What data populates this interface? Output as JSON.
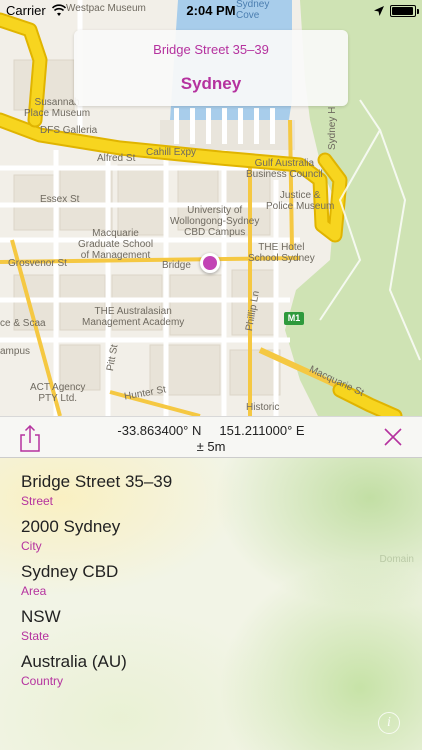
{
  "status_bar": {
    "carrier": "Carrier",
    "wifi_icon": "wifi-icon",
    "time": "2:04 PM",
    "location_icon": "location-arrow-icon",
    "battery_level": 0.95
  },
  "map": {
    "labels": {
      "westpac": "Westpac Museum",
      "sydney_cove": "Sydney\nCove",
      "susannah": "Susannah\nPlace Museum",
      "dfs": "DFS Galleria",
      "cahill": "Cahill Expy",
      "alfred": "Alfred St",
      "gulf": "Gulf Australia\nBusiness Council",
      "justice": "Justice &\nPolice Museum",
      "essex": "Essex St",
      "uow": "University of\nWollongong-Sydney\nCBD Campus",
      "macquarie_grad": "Macquarie\nGraduate School\nof Management",
      "hotel": "THE Hotel\nSchool Sydney",
      "grosvenor": "Grosvenor St",
      "bridge": "Bridge",
      "aus_mgmt": "THE Australasian\nManagement Academy",
      "phillip": "Phillip Ln",
      "pitt": "Pitt St",
      "hunter": "Hunter St",
      "act_agency": "ACT Agency\nPTY Ltd.",
      "historic": "Historic",
      "macquarie_st": "Macquarie St",
      "sydney_h": "Sydney H",
      "scaa": "ce & Scaa",
      "campus": "ampus",
      "m1": "M1"
    }
  },
  "callout": {
    "subtitle": "Bridge Street 35–39",
    "title": "Sydney"
  },
  "coordinates": {
    "latitude": "-33.863400° N",
    "longitude": "151.211000° E",
    "accuracy": "± 5m"
  },
  "address": [
    {
      "value": "Bridge Street 35–39",
      "label": "Street"
    },
    {
      "value": "2000 Sydney",
      "label": "City"
    },
    {
      "value": "Sydney CBD",
      "label": "Area"
    },
    {
      "value": "NSW",
      "label": "State"
    },
    {
      "value": "Australia (AU)",
      "label": "Country"
    }
  ],
  "colors": {
    "accent": "#b5329f",
    "pin": "#c243b5",
    "freeway": "#f7d51f",
    "park": "#cfe3b4",
    "water": "#a8cdeb"
  },
  "info_label": "i",
  "domain_watermark": "Domain"
}
